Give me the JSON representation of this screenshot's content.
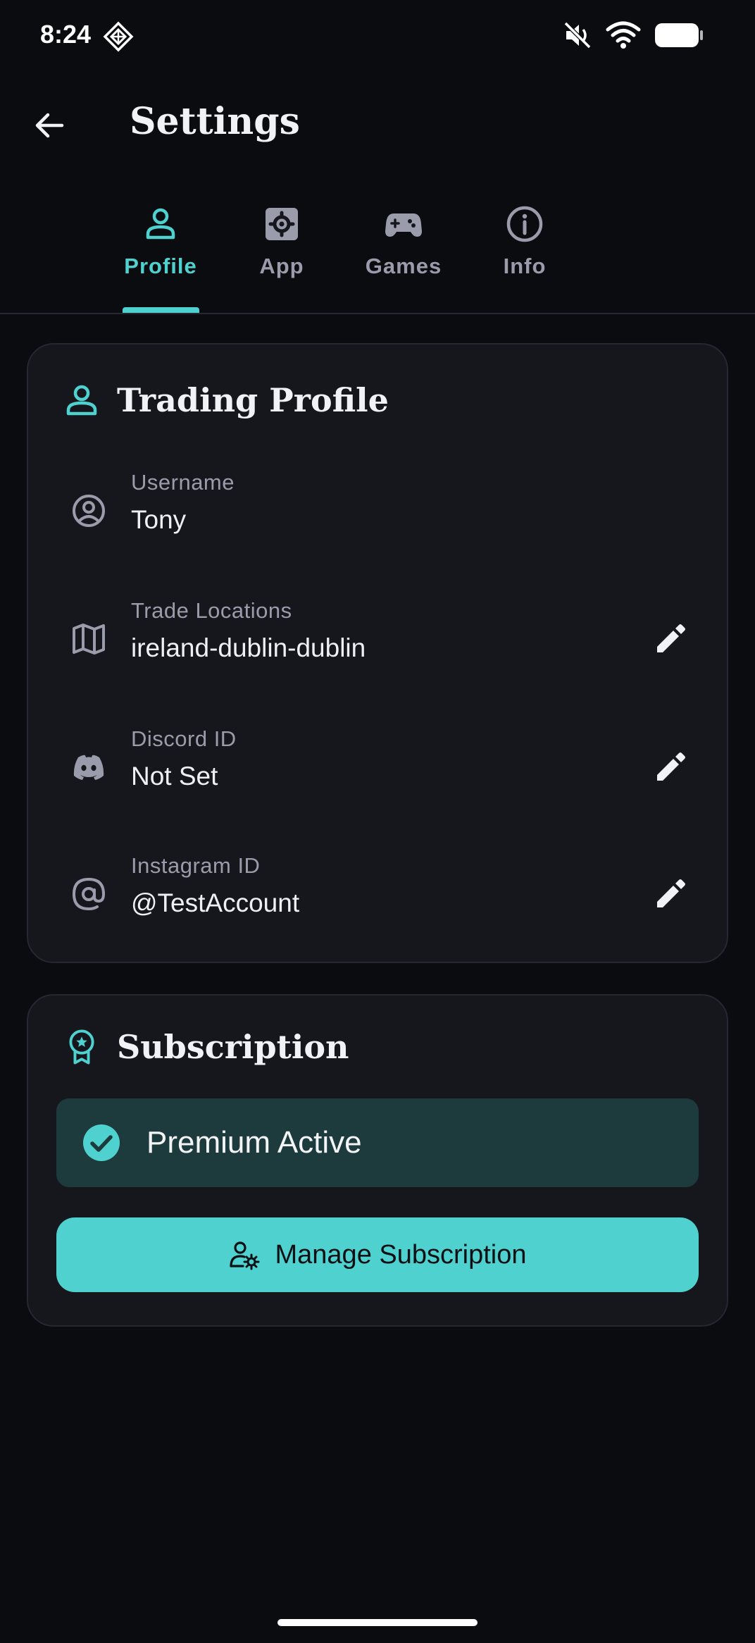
{
  "status_bar": {
    "time": "8:24"
  },
  "header": {
    "title": "Settings"
  },
  "tabs": [
    {
      "label": "Profile",
      "icon": "person-icon",
      "active": true
    },
    {
      "label": "App",
      "icon": "settings-box-icon",
      "active": false
    },
    {
      "label": "Games",
      "icon": "gamepad-icon",
      "active": false
    },
    {
      "label": "Info",
      "icon": "info-icon",
      "active": false
    }
  ],
  "trading_profile": {
    "title": "Trading Profile",
    "fields": [
      {
        "label": "Username",
        "value": "Tony",
        "icon": "account-circle-icon",
        "editable": false
      },
      {
        "label": "Trade Locations",
        "value": "ireland-dublin-dublin",
        "icon": "map-icon",
        "editable": true
      },
      {
        "label": "Discord ID",
        "value": "Not Set",
        "icon": "discord-icon",
        "editable": true
      },
      {
        "label": "Instagram ID",
        "value": "@TestAccount",
        "icon": "at-sign-icon",
        "editable": true
      }
    ]
  },
  "subscription": {
    "title": "Subscription",
    "status": "Premium Active",
    "manage_label": "Manage Subscription"
  },
  "colors": {
    "accent": "#4fd1cf",
    "background": "#0b0c10",
    "card": "#16171d",
    "premium_box": "#1d3a3d"
  }
}
